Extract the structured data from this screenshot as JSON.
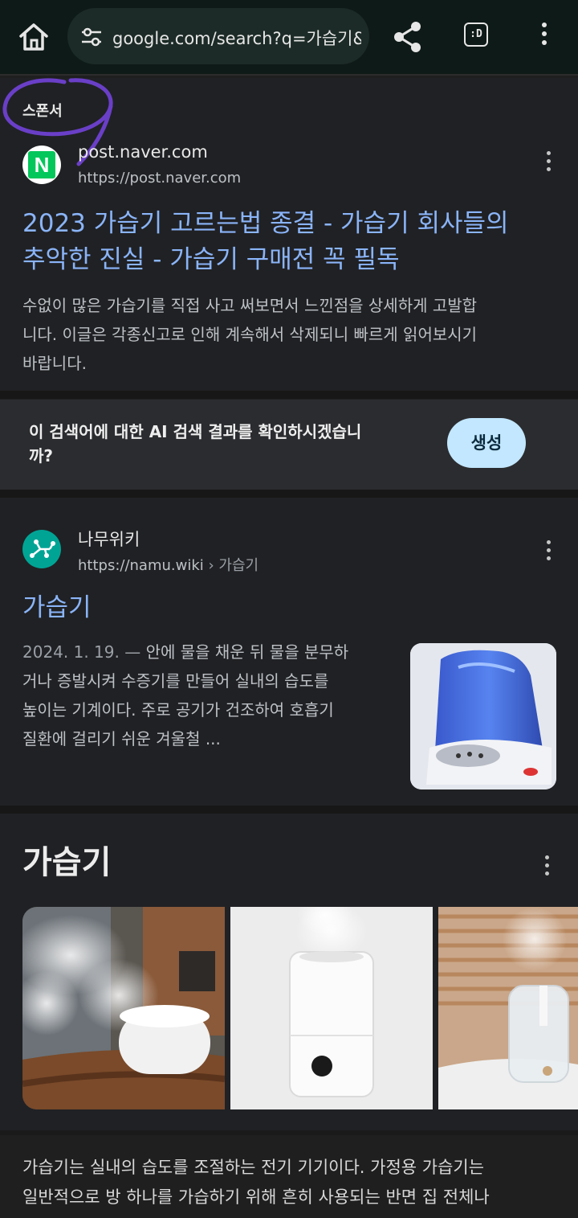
{
  "browser": {
    "url": "google.com/search?q=가습기&c",
    "tabs_label": ":D"
  },
  "sponsored": {
    "label": "스폰서",
    "site_name": "post.naver.com",
    "site_url": "https://post.naver.com",
    "favicon_letter": "N",
    "title_line1": "2023 가습기 고르는법 종결 - 가습기 회사들의",
    "title_line2": "추악한 진실 - 가습기 구매전 꼭 필독",
    "snippet_line1": "수없이 많은 가습기를 직접 사고 써보면서 느낀점을 상세하게 고발합",
    "snippet_line2": "니다. 이글은 각종신고로 인해 계속해서 삭제되니 빠르게 읽어보시기",
    "snippet_line3": "바랍니다."
  },
  "ai_prompt": {
    "text_line1": "이 검색어에 대한 AI 검색 결과를 확인하시겠습니",
    "text_line2": "까?",
    "button_label": "생성"
  },
  "namu": {
    "site_name": "나무위키",
    "site_url": "https://namu.wiki",
    "breadcrumb": "› 가습기",
    "title": "가습기",
    "date": "2024. 1. 19. —",
    "snippet_line1": " 안에 물을 채운 뒤 물을 분무하",
    "snippet_line2": "거나 증발시켜 수증기를 만들어 실내의 습도를",
    "snippet_line3": "높이는 기계이다. 주로 공기가 건조하여 호흡기",
    "snippet_line4": "질환에 걸리기 쉬운 겨울철 ..."
  },
  "knowledge_panel": {
    "title": "가습기",
    "desc_line1": "가습기는 실내의 습도를 조절하는 전기 기기이다. 가정용 가습기는",
    "desc_line2": "일반적으로 방 하나를 가습하기 위해 흔히 사용되는 반면 집 전체나"
  },
  "colors": {
    "link": "#8ab4f8",
    "button_bg": "#c2e7ff",
    "scribble": "#6a3fc7",
    "naver_green": "#03c75a",
    "namu_green": "#00a495"
  }
}
